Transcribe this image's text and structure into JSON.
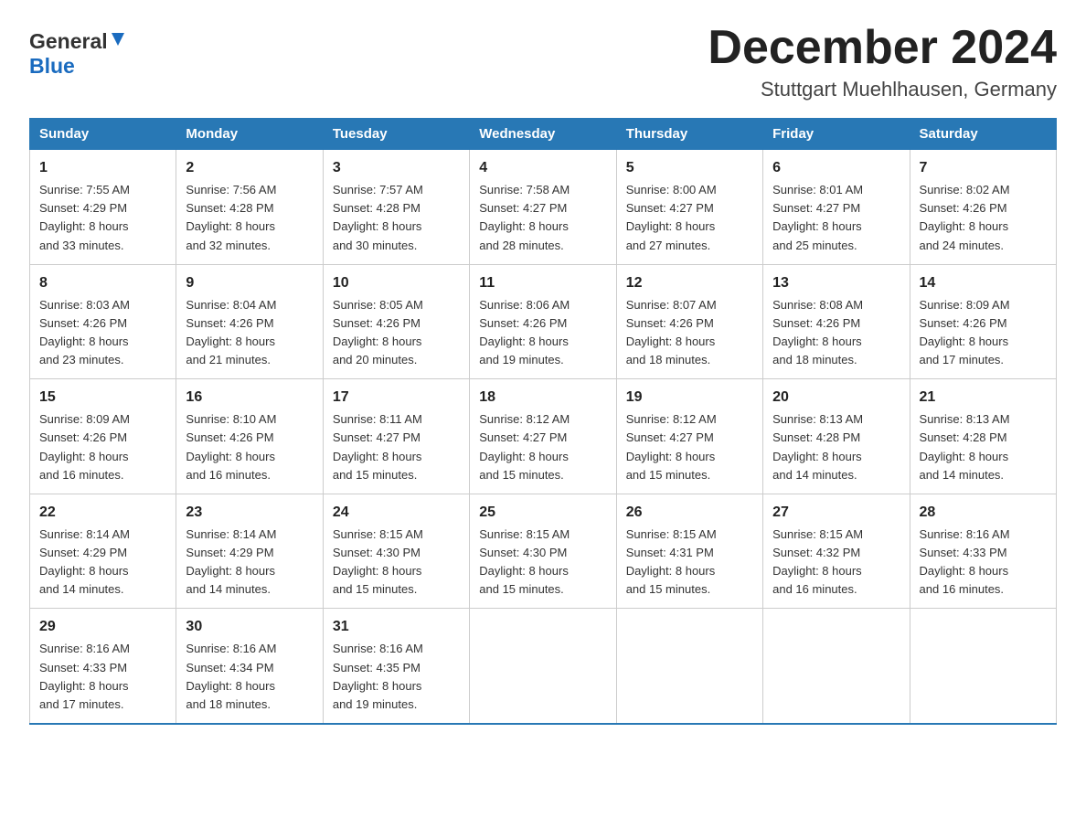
{
  "header": {
    "title": "December 2024",
    "subtitle": "Stuttgart Muehlhausen, Germany",
    "logo_general": "General",
    "logo_blue": "Blue"
  },
  "days_of_week": [
    "Sunday",
    "Monday",
    "Tuesday",
    "Wednesday",
    "Thursday",
    "Friday",
    "Saturday"
  ],
  "weeks": [
    [
      {
        "day": "1",
        "sunrise": "7:55 AM",
        "sunset": "4:29 PM",
        "daylight": "8 hours and 33 minutes."
      },
      {
        "day": "2",
        "sunrise": "7:56 AM",
        "sunset": "4:28 PM",
        "daylight": "8 hours and 32 minutes."
      },
      {
        "day": "3",
        "sunrise": "7:57 AM",
        "sunset": "4:28 PM",
        "daylight": "8 hours and 30 minutes."
      },
      {
        "day": "4",
        "sunrise": "7:58 AM",
        "sunset": "4:27 PM",
        "daylight": "8 hours and 28 minutes."
      },
      {
        "day": "5",
        "sunrise": "8:00 AM",
        "sunset": "4:27 PM",
        "daylight": "8 hours and 27 minutes."
      },
      {
        "day": "6",
        "sunrise": "8:01 AM",
        "sunset": "4:27 PM",
        "daylight": "8 hours and 25 minutes."
      },
      {
        "day": "7",
        "sunrise": "8:02 AM",
        "sunset": "4:26 PM",
        "daylight": "8 hours and 24 minutes."
      }
    ],
    [
      {
        "day": "8",
        "sunrise": "8:03 AM",
        "sunset": "4:26 PM",
        "daylight": "8 hours and 23 minutes."
      },
      {
        "day": "9",
        "sunrise": "8:04 AM",
        "sunset": "4:26 PM",
        "daylight": "8 hours and 21 minutes."
      },
      {
        "day": "10",
        "sunrise": "8:05 AM",
        "sunset": "4:26 PM",
        "daylight": "8 hours and 20 minutes."
      },
      {
        "day": "11",
        "sunrise": "8:06 AM",
        "sunset": "4:26 PM",
        "daylight": "8 hours and 19 minutes."
      },
      {
        "day": "12",
        "sunrise": "8:07 AM",
        "sunset": "4:26 PM",
        "daylight": "8 hours and 18 minutes."
      },
      {
        "day": "13",
        "sunrise": "8:08 AM",
        "sunset": "4:26 PM",
        "daylight": "8 hours and 18 minutes."
      },
      {
        "day": "14",
        "sunrise": "8:09 AM",
        "sunset": "4:26 PM",
        "daylight": "8 hours and 17 minutes."
      }
    ],
    [
      {
        "day": "15",
        "sunrise": "8:09 AM",
        "sunset": "4:26 PM",
        "daylight": "8 hours and 16 minutes."
      },
      {
        "day": "16",
        "sunrise": "8:10 AM",
        "sunset": "4:26 PM",
        "daylight": "8 hours and 16 minutes."
      },
      {
        "day": "17",
        "sunrise": "8:11 AM",
        "sunset": "4:27 PM",
        "daylight": "8 hours and 15 minutes."
      },
      {
        "day": "18",
        "sunrise": "8:12 AM",
        "sunset": "4:27 PM",
        "daylight": "8 hours and 15 minutes."
      },
      {
        "day": "19",
        "sunrise": "8:12 AM",
        "sunset": "4:27 PM",
        "daylight": "8 hours and 15 minutes."
      },
      {
        "day": "20",
        "sunrise": "8:13 AM",
        "sunset": "4:28 PM",
        "daylight": "8 hours and 14 minutes."
      },
      {
        "day": "21",
        "sunrise": "8:13 AM",
        "sunset": "4:28 PM",
        "daylight": "8 hours and 14 minutes."
      }
    ],
    [
      {
        "day": "22",
        "sunrise": "8:14 AM",
        "sunset": "4:29 PM",
        "daylight": "8 hours and 14 minutes."
      },
      {
        "day": "23",
        "sunrise": "8:14 AM",
        "sunset": "4:29 PM",
        "daylight": "8 hours and 14 minutes."
      },
      {
        "day": "24",
        "sunrise": "8:15 AM",
        "sunset": "4:30 PM",
        "daylight": "8 hours and 15 minutes."
      },
      {
        "day": "25",
        "sunrise": "8:15 AM",
        "sunset": "4:30 PM",
        "daylight": "8 hours and 15 minutes."
      },
      {
        "day": "26",
        "sunrise": "8:15 AM",
        "sunset": "4:31 PM",
        "daylight": "8 hours and 15 minutes."
      },
      {
        "day": "27",
        "sunrise": "8:15 AM",
        "sunset": "4:32 PM",
        "daylight": "8 hours and 16 minutes."
      },
      {
        "day": "28",
        "sunrise": "8:16 AM",
        "sunset": "4:33 PM",
        "daylight": "8 hours and 16 minutes."
      }
    ],
    [
      {
        "day": "29",
        "sunrise": "8:16 AM",
        "sunset": "4:33 PM",
        "daylight": "8 hours and 17 minutes."
      },
      {
        "day": "30",
        "sunrise": "8:16 AM",
        "sunset": "4:34 PM",
        "daylight": "8 hours and 18 minutes."
      },
      {
        "day": "31",
        "sunrise": "8:16 AM",
        "sunset": "4:35 PM",
        "daylight": "8 hours and 19 minutes."
      },
      null,
      null,
      null,
      null
    ]
  ],
  "labels": {
    "sunrise": "Sunrise:",
    "sunset": "Sunset:",
    "daylight": "Daylight:"
  }
}
